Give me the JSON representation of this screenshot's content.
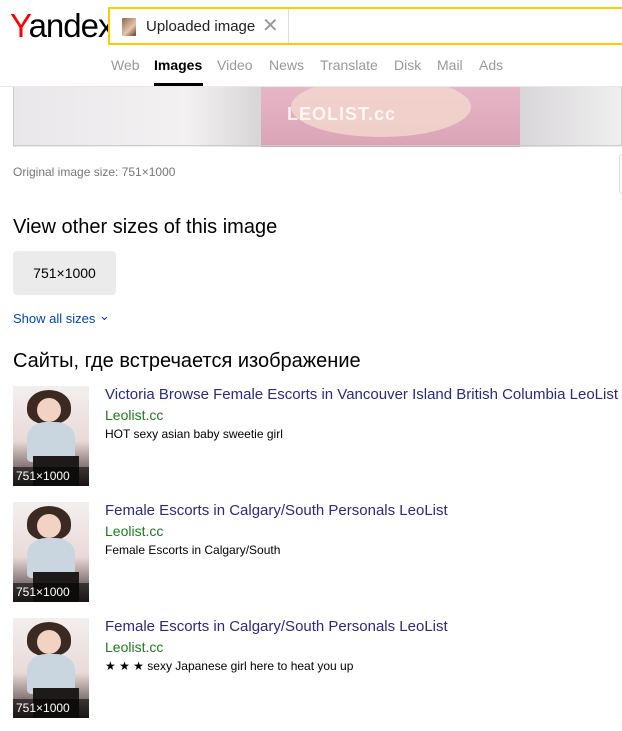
{
  "header": {
    "logo": {
      "first": "Y",
      "rest": "andex"
    },
    "search_label": "Uploaded image",
    "clear_glyph": "✕",
    "tabs": [
      "Web",
      "Images",
      "Video",
      "News",
      "Translate",
      "Disk",
      "Mail",
      "Ads"
    ],
    "active_tab": "Images"
  },
  "preview": {
    "watermark": "LEOLIST.cc"
  },
  "original_size": "Original image size: 751×1000",
  "other_sizes": {
    "heading": "View other sizes of this image",
    "chip": "751×1000",
    "show_all": "Show all sizes",
    "chevron": "⌄"
  },
  "sites": {
    "heading": "Сайты, где встречается изображение",
    "items": [
      {
        "title": "Victoria Browse Female Escorts in Vancouver Island British Columbia LeoList",
        "domain": "Leolist.cc",
        "description": "HOT sexy asian baby sweetie girl",
        "size": "751×1000"
      },
      {
        "title": "Female Escorts in Calgary/South Personals LeoList",
        "domain": "Leolist.cc",
        "description": "Female Escorts in Calgary/South",
        "size": "751×1000"
      },
      {
        "title": "Female Escorts in Calgary/South Personals LeoList",
        "domain": "Leolist.cc",
        "description": "★ ★ ★ sexy Japanese girl here to heat you up",
        "size": "751×1000"
      }
    ]
  },
  "colors": {
    "search_border": "#ffcc00",
    "logo_y": "#ff0000",
    "link": "#2a2a7e",
    "domain": "#1f7a1f"
  }
}
